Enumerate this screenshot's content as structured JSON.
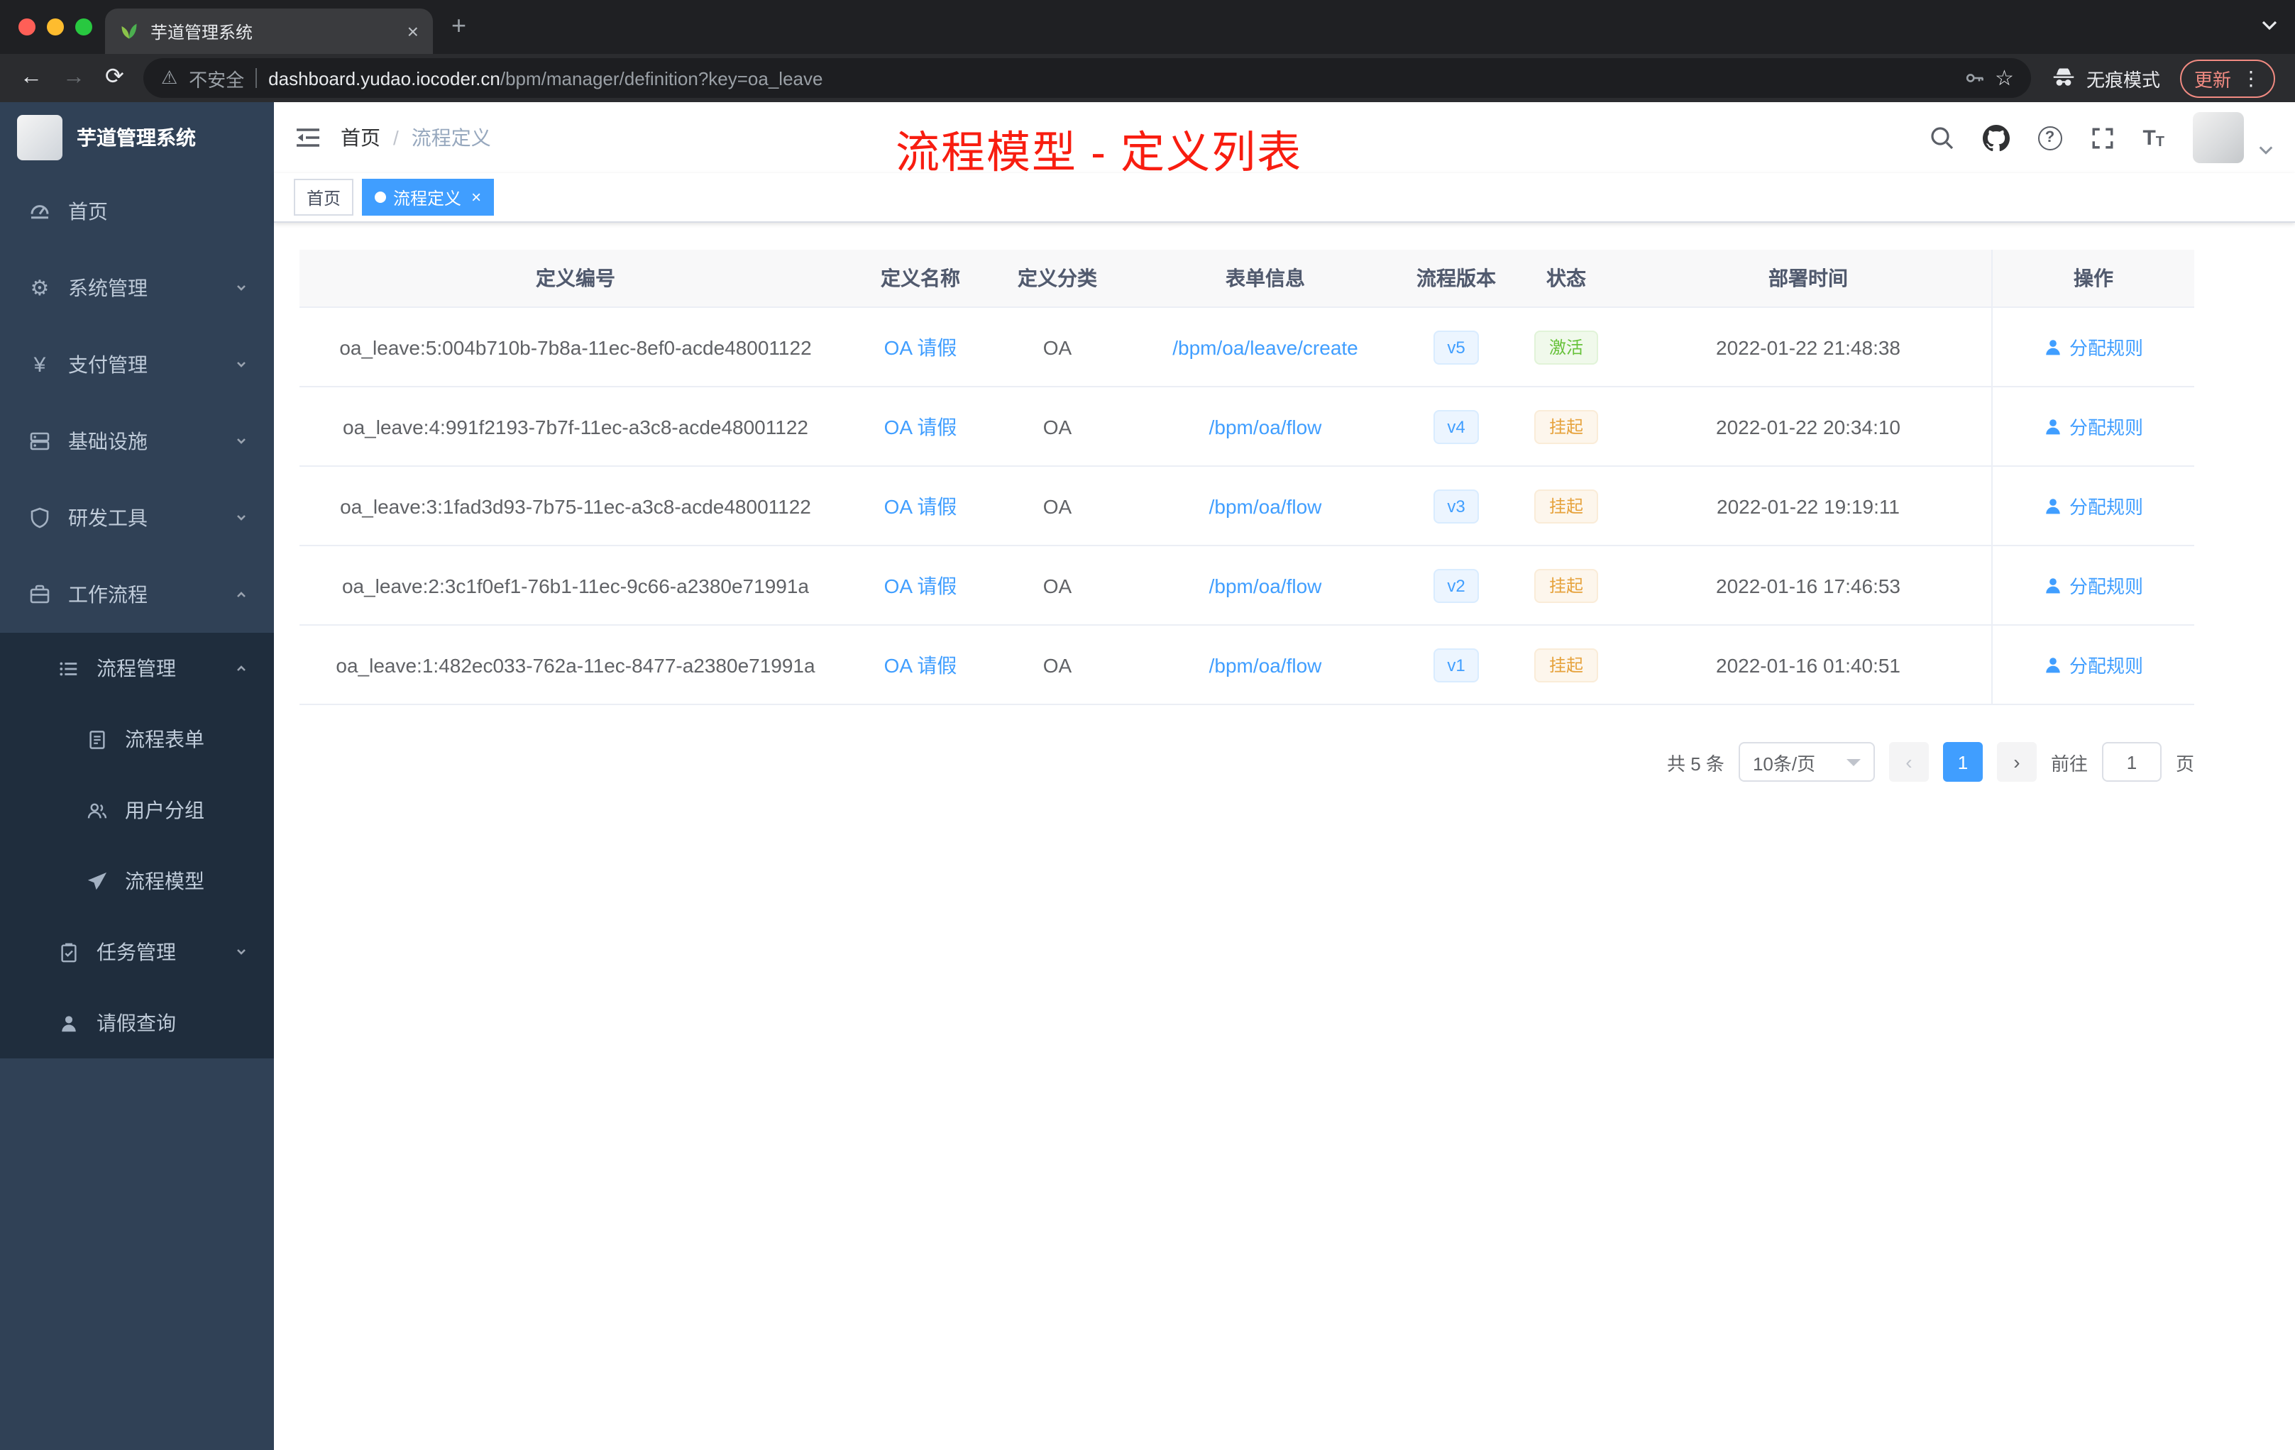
{
  "colors": {
    "accent": "#409eff",
    "success": "#67c23a",
    "warning": "#e6a23c",
    "annotation_red": "#f81d10",
    "sidebar_bg": "#304156",
    "sidebar_submenu_bg": "#1f2d3d"
  },
  "icons": {
    "back": "←",
    "forward": "→",
    "reload": "⟳",
    "warning": "⚠",
    "star": "☆",
    "menu_dots": "⋮",
    "new_tab": "+",
    "tab_close": "×",
    "close": "×",
    "prev": "‹",
    "next": "›",
    "question": "?",
    "gear": "⚙",
    "yen": "¥",
    "font_large": "T",
    "font_small": "T"
  },
  "browser": {
    "tab_title": "芋道管理系统",
    "security_label": "不安全",
    "url_domain": "dashboard.yudao.iocoder.cn",
    "url_path": "/bpm/manager/definition?key=oa_leave",
    "incognito_label": "无痕模式",
    "update_label": "更新"
  },
  "sidebar": {
    "logo_title": "芋道管理系统",
    "items": [
      {
        "label": "首页",
        "icon": "dashboard-icon"
      },
      {
        "label": "系统管理",
        "icon": "gear-icon"
      },
      {
        "label": "支付管理",
        "icon": "payment-icon"
      },
      {
        "label": "基础设施",
        "icon": "infrastructure-icon"
      },
      {
        "label": "研发工具",
        "icon": "devtools-icon"
      },
      {
        "label": "工作流程",
        "icon": "workflow-icon"
      },
      {
        "label": "流程管理",
        "icon": "process-list-icon"
      },
      {
        "label": "流程表单",
        "icon": "form-icon"
      },
      {
        "label": "用户分组",
        "icon": "user-group-icon"
      },
      {
        "label": "流程模型",
        "icon": "paper-plane-icon"
      },
      {
        "label": "任务管理",
        "icon": "task-icon"
      },
      {
        "label": "请假查询",
        "icon": "person-icon"
      }
    ]
  },
  "navbar": {
    "breadcrumb_home": "首页",
    "breadcrumb_sep": "/",
    "breadcrumb_current": "流程定义"
  },
  "annotation": {
    "text": "流程模型 - 定义列表"
  },
  "tags": {
    "home": "首页",
    "active": "流程定义"
  },
  "table": {
    "headers": {
      "id": "定义编号",
      "name": "定义名称",
      "category": "定义分类",
      "form": "表单信息",
      "version": "流程版本",
      "status": "状态",
      "deploy_time": "部署时间",
      "actions": "操作"
    },
    "rows": [
      {
        "id": "oa_leave:5:004b710b-7b8a-11ec-8ef0-acde48001122",
        "name": "OA 请假",
        "category": "OA",
        "form": "/bpm/oa/leave/create",
        "version": "v5",
        "status": "激活",
        "status_type": "success",
        "time": "2022-01-22 21:48:38",
        "action": "分配规则"
      },
      {
        "id": "oa_leave:4:991f2193-7b7f-11ec-a3c8-acde48001122",
        "name": "OA 请假",
        "category": "OA",
        "form": "/bpm/oa/flow",
        "version": "v4",
        "status": "挂起",
        "status_type": "warning",
        "time": "2022-01-22 20:34:10",
        "action": "分配规则"
      },
      {
        "id": "oa_leave:3:1fad3d93-7b75-11ec-a3c8-acde48001122",
        "name": "OA 请假",
        "category": "OA",
        "form": "/bpm/oa/flow",
        "version": "v3",
        "status": "挂起",
        "status_type": "warning",
        "time": "2022-01-22 19:19:11",
        "action": "分配规则"
      },
      {
        "id": "oa_leave:2:3c1f0ef1-76b1-11ec-9c66-a2380e71991a",
        "name": "OA 请假",
        "category": "OA",
        "form": "/bpm/oa/flow",
        "version": "v2",
        "status": "挂起",
        "status_type": "warning",
        "time": "2022-01-16 17:46:53",
        "action": "分配规则"
      },
      {
        "id": "oa_leave:1:482ec033-762a-11ec-8477-a2380e71991a",
        "name": "OA 请假",
        "category": "OA",
        "form": "/bpm/oa/flow",
        "version": "v1",
        "status": "挂起",
        "status_type": "warning",
        "time": "2022-01-16 01:40:51",
        "action": "分配规则"
      }
    ]
  },
  "pagination": {
    "total": "共 5 条",
    "page_size": "10条/页",
    "current_page": "1",
    "goto_label": "前往",
    "goto_value": "1",
    "goto_unit": "页"
  }
}
